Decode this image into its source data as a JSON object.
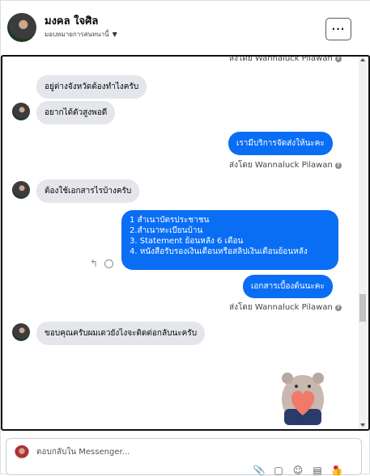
{
  "header": {
    "contact_name": "มงคล ใจศิล",
    "assign_label": "มอบหมายการสนทนานี้",
    "more_label": "···"
  },
  "messages": {
    "sender_top": "ส่งโดย Wannaluck Pilawan",
    "in_1": "อยู่ต่างจังหวัดต้องทำไงครับ",
    "in_2": "อยากได้ตัวสูงพอดี",
    "out_1": "เรามีบริการจัดส่งให้นะคะ",
    "sender_1": "ส่งโดย Wannaluck Pilawan",
    "in_3": "ต้องใช้เอกสารไรบ้างครับ",
    "out_list": [
      "1 สำเนาบัตรประชาชน",
      "2.สำเนาทะเบียนบ้าน",
      " 3. Statement ย้อนหลัง 6 เดือน",
      "4. หนังสือรับรองเงินเดือนหรือสลิปเงินเดือนย้อนหลัง"
    ],
    "out_2": "เอกสารเบื้องต้นนะคะ",
    "sender_2": "ส่งโดย Wannaluck Pilawan",
    "in_4": "ขอบคุณครับผมเดวยังไงจะติดต่อกลับนะครับ",
    "info_glyph": "?"
  },
  "composer": {
    "placeholder": "ตอบกลับใน Messenger...",
    "icons": [
      "paperclip-icon",
      "gif-icon",
      "emoji-icon",
      "saved-reply-icon",
      "like-icon"
    ]
  },
  "colors": {
    "outgoing_bubble": "#0a6ef5",
    "incoming_bubble": "#e4e6eb",
    "notification_dot": "#e41e3f"
  }
}
